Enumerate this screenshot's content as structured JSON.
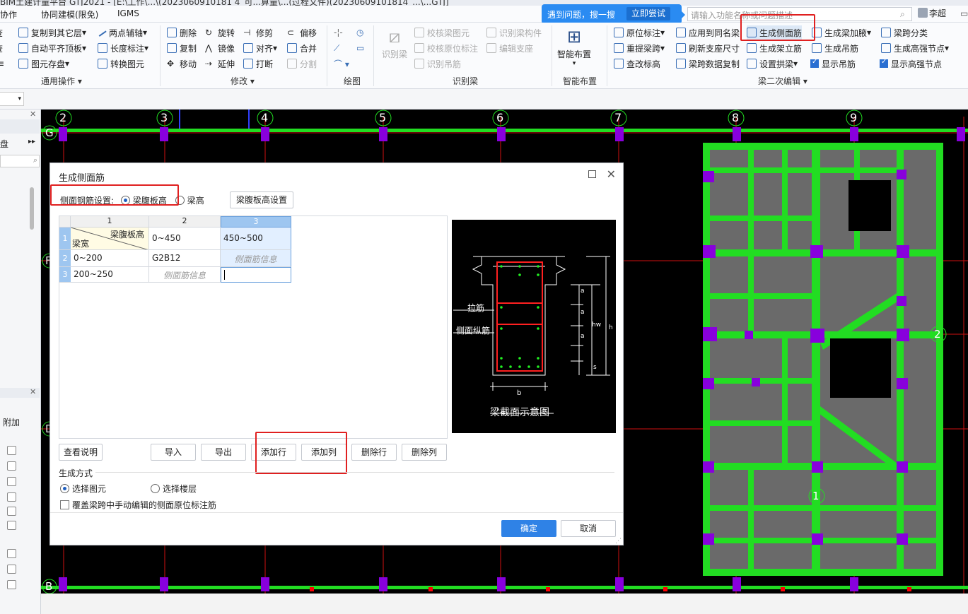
{
  "app": {
    "title_fragment": "BIM土建计量平台 GTJ2021 - [E:\\工作\\...\\(2023060910181 4_可...算量\\...(过程文件)(20230609101814_...\\...GTJ]"
  },
  "menu": {
    "items": [
      "协作",
      "协同建模(限免)",
      "IGMS"
    ]
  },
  "tip": {
    "text": "遇到问题，搜一搜",
    "button": "立即尝试"
  },
  "search": {
    "placeholder": "请输入功能名称或问题描述"
  },
  "user": {
    "name": "李超"
  },
  "ribbon": {
    "common": {
      "copy_to_other": "复制到其它层",
      "auto_flat_top": "自动平齐顶板",
      "save_element": "图元存盘",
      "two_point_axis": "两点辅轴",
      "length_dim": "长度标注",
      "convert_element": "转换图元",
      "group": "通用操作",
      "query": "查",
      "disk": "盘"
    },
    "modify": {
      "delete": "删除",
      "rotate": "旋转",
      "trim": "修剪",
      "offset": "偏移",
      "copy": "复制",
      "mirror": "镜像",
      "align": "对齐",
      "merge": "合并",
      "move": "移动",
      "extend": "延伸",
      "break": "打断",
      "split": "分割",
      "group": "修改"
    },
    "draw": {
      "group": "绘图"
    },
    "recognize": {
      "recognize_beam": "识别梁",
      "check_beam": "校核梁图元",
      "check_label": "校核原位标注",
      "recognize_hanger": "识别吊筋",
      "recognize_member": "识别梁构件",
      "edit_support": "编辑支座",
      "group": "识别梁"
    },
    "smart": {
      "label": "智能布置",
      "group": "智能布置"
    },
    "beam2": {
      "in_place": "原位标注",
      "apply_same": "应用到同名梁",
      "gen_side_bar": "生成侧面筋",
      "gen_haunch": "生成梁加腋",
      "span_class": "梁跨分类",
      "re_extract": "重提梁跨",
      "refresh_support": "刷新支座尺寸",
      "gen_erect": "生成架立筋",
      "gen_hanger": "生成吊筋",
      "gen_high_node": "生成高强节点",
      "check_elev": "查改标高",
      "span_copy": "梁跨数据复制",
      "set_arch": "设置拱梁",
      "show_hanger": "显示吊筋",
      "show_high_node": "显示高强节点",
      "group": "梁二次编辑"
    }
  },
  "left_panel": {
    "label1": "盘",
    "label2": "附加"
  },
  "axes": {
    "top": [
      "2",
      "3",
      "4",
      "5",
      "6",
      "7",
      "8",
      "9"
    ],
    "left": [
      "G",
      "F",
      "D",
      "B"
    ],
    "circ": [
      "2",
      "1"
    ]
  },
  "dialog": {
    "title": "生成侧面筋",
    "setting_label": "侧面钢筋设置:",
    "opt_web": "梁腹板高",
    "opt_height": "梁高",
    "web_setting_btn": "梁腹板高设置",
    "col_heads": [
      "1",
      "2",
      "3"
    ],
    "row_heads": [
      "1",
      "2",
      "3"
    ],
    "corner_top": "梁腹板高",
    "corner_bottom": "梁宽",
    "cells": [
      [
        "0~450",
        "450~500"
      ],
      [
        "0~200",
        "G2B12",
        "侧面筋信息"
      ],
      [
        "200~250",
        "侧面筋信息",
        ""
      ]
    ],
    "preview": {
      "caption": "梁截面示意图",
      "tie": "拉筋",
      "side_long": "侧面纵筋",
      "a": "a",
      "hw": "hw",
      "h": "h",
      "s": "s",
      "b": "b"
    },
    "buttons": {
      "help": "查看说明",
      "import": "导入",
      "export": "导出",
      "add_row": "添加行",
      "add_col": "添加列",
      "del_row": "删除行",
      "del_col": "删除列",
      "ok": "确定",
      "cancel": "取消"
    },
    "gen_mode": "生成方式",
    "mode_select": "选择图元",
    "mode_floor": "选择楼层",
    "override": "覆盖梁跨中手动编辑的侧面原位标注筋"
  }
}
